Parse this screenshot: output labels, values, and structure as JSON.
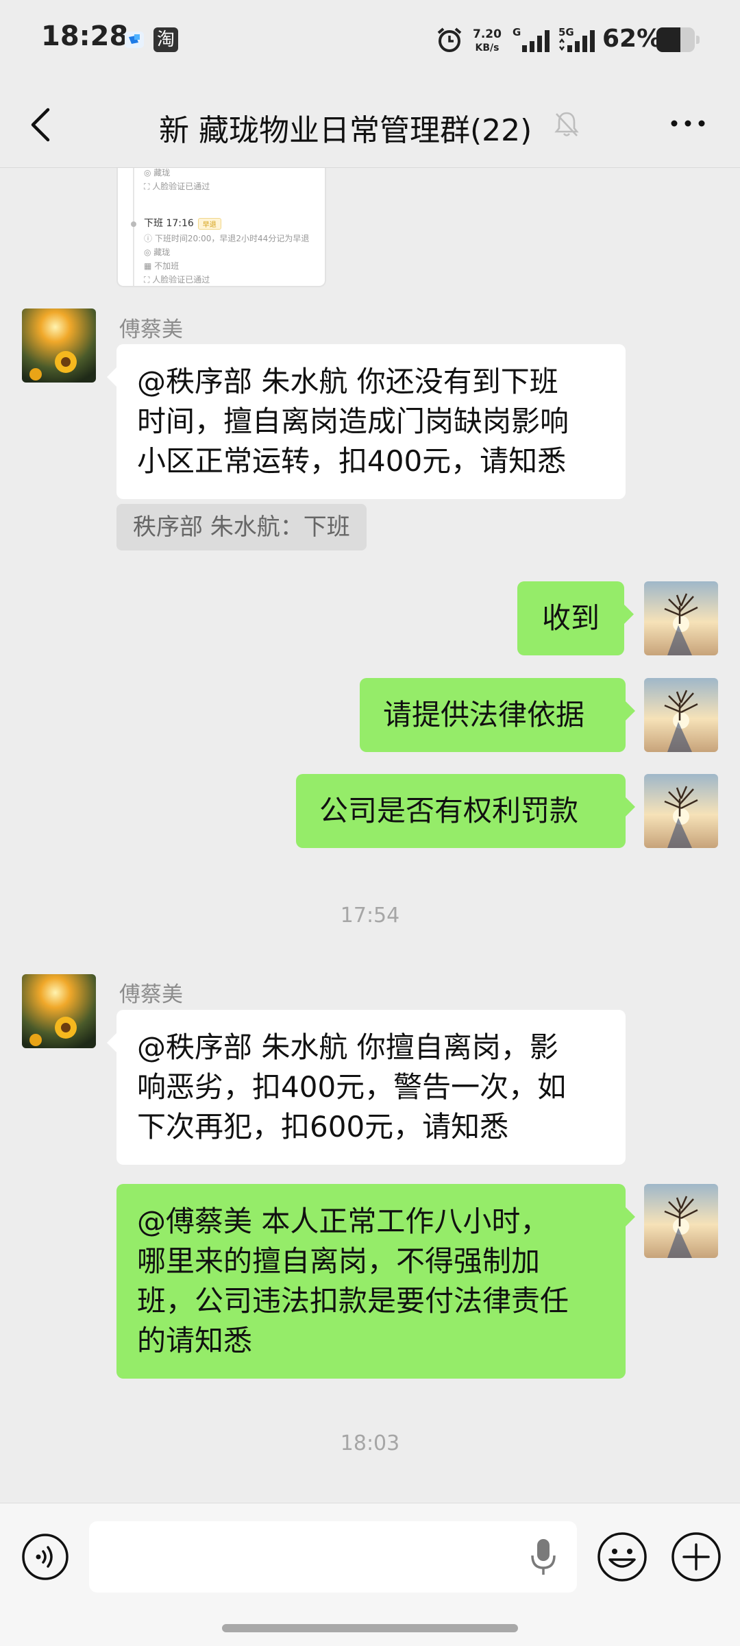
{
  "status_bar": {
    "time": "18:28",
    "app_icon_taobao": "淘",
    "net_speed_value": "7.20",
    "net_speed_unit": "KB/s",
    "sim1_label": "G",
    "sim2_label": "5G",
    "battery_text": "62%",
    "battery_level": 0.62
  },
  "header": {
    "title": "新 藏珑物业日常管理群(22)",
    "icons": [
      "back-icon",
      "mute-bell-icon",
      "more-icon"
    ]
  },
  "attendance_card": {
    "rows": [
      {
        "icon": "location-icon",
        "text": "藏珑"
      },
      {
        "icon": "face-icon",
        "text": "人脸验证已通过"
      },
      {
        "icon": "dot-icon",
        "text": "下班 17:16",
        "tag": "早退"
      },
      {
        "icon": "info-icon",
        "text": "下班时间20:00，早退2小时44分记为早退"
      },
      {
        "icon": "location-icon",
        "text": "藏珑"
      },
      {
        "icon": "calendar-icon",
        "text": "不加班"
      },
      {
        "icon": "face-icon",
        "text": "人脸验证已通过"
      }
    ]
  },
  "messages": [
    {
      "type": "incoming",
      "sender": "傅蔡美",
      "lines": [
        "@秩序部 朱水航  你还没有到下班",
        "时间，擅自离岗造成门岗缺岗影响",
        "小区正常运转，扣400元，请知悉"
      ]
    },
    {
      "type": "quote",
      "text": "秩序部 朱水航：下班"
    },
    {
      "type": "outgoing",
      "lines": [
        "收到"
      ]
    },
    {
      "type": "outgoing",
      "lines": [
        "请提供法律依据"
      ]
    },
    {
      "type": "outgoing",
      "lines": [
        "公司是否有权利罚款"
      ]
    },
    {
      "type": "timestamp",
      "text": "17:54"
    },
    {
      "type": "incoming",
      "sender": "傅蔡美",
      "lines": [
        "@秩序部 朱水航  你擅自离岗，影",
        "响恶劣，扣400元，警告一次，如",
        "下次再犯，扣600元，请知悉"
      ]
    },
    {
      "type": "outgoing",
      "lines": [
        "@傅蔡美  本人正常工作八小时，",
        "哪里来的擅自离岗，不得强制加",
        "班，公司违法扣款是要付法律责任",
        "的请知悉"
      ]
    },
    {
      "type": "timestamp",
      "text": "18:03"
    }
  ],
  "input_bar": {
    "value": "",
    "icons": [
      "voice-icon",
      "mic-icon",
      "emoji-icon",
      "plus-icon"
    ]
  },
  "colors": {
    "background": "#ededed",
    "outgoing_bubble": "#95ec69",
    "incoming_bubble": "#ffffff",
    "timestamp_text": "#a6a6a6"
  }
}
